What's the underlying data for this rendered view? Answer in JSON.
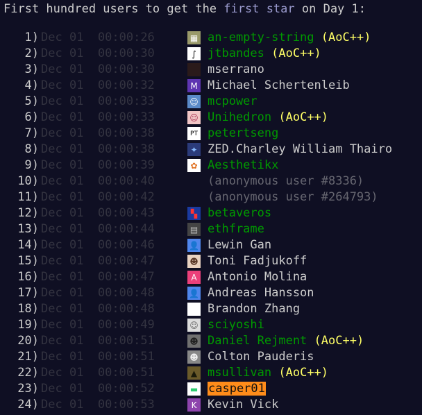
{
  "heading": {
    "prefix": "First hundred users to get the ",
    "highlight": "first star",
    "suffix": " on Day 1:"
  },
  "colors": {
    "background": "#0f0f23",
    "text": "#cccccc",
    "link_green": "#009900",
    "supporter_yellow": "#ffff66",
    "time_dim": "#333340",
    "highlight": "#9999cc",
    "sponsor_orange": "#ff8c1a"
  },
  "rows": [
    {
      "rank": "1)",
      "date": "Dec 01",
      "time": "00:00:26",
      "name": "an-empty-string",
      "supporter": "(AoC++)",
      "style": "linked",
      "avatar": {
        "icon": "pixel-art-avatar-icon",
        "bg": "#9a9a6a",
        "glyph": "▦"
      }
    },
    {
      "rank": "2)",
      "date": "Dec 01",
      "time": "00:00:30",
      "name": "jtbandes",
      "supporter": "(AoC++)",
      "style": "linked",
      "avatar": {
        "icon": "integral-sign-avatar-icon",
        "bg": "#ffffff",
        "glyph": "∫",
        "fg": "#000000"
      }
    },
    {
      "rank": "3)",
      "date": "Dec 01",
      "time": "00:00:30",
      "name": "mserrano",
      "supporter": "",
      "style": "plain",
      "avatar": {
        "icon": "dark-photo-avatar-icon",
        "bg": "#2a1a1a",
        "glyph": ""
      }
    },
    {
      "rank": "4)",
      "date": "Dec 01",
      "time": "00:00:32",
      "name": "Michael Schertenleib",
      "supporter": "",
      "style": "plain",
      "avatar": {
        "icon": "letter-m-avatar-icon",
        "bg": "#5e35b1",
        "glyph": "M"
      }
    },
    {
      "rank": "5)",
      "date": "Dec 01",
      "time": "00:00:33",
      "name": "mcpower",
      "supporter": "",
      "style": "linked",
      "avatar": {
        "icon": "anime-character-avatar-icon",
        "bg": "#5a8ac8",
        "glyph": "☺"
      }
    },
    {
      "rank": "6)",
      "date": "Dec 01",
      "time": "00:00:33",
      "name": "Unihedron",
      "supporter": "(AoC++)",
      "style": "linked",
      "avatar": {
        "icon": "anime-girl-avatar-icon",
        "bg": "#f2c6c6",
        "glyph": "☺",
        "fg": "#aa3355"
      }
    },
    {
      "rank": "7)",
      "date": "Dec 01",
      "time": "00:00:38",
      "name": "petertseng",
      "supporter": "",
      "style": "linked",
      "avatar": {
        "icon": "pt-monogram-avatar-icon",
        "bg": "#ffffff",
        "glyph": "PT",
        "fg": "#000000"
      }
    },
    {
      "rank": "8)",
      "date": "Dec 01",
      "time": "00:00:38",
      "name": "ZED.Charley William Thairo",
      "supporter": "",
      "style": "plain",
      "avatar": {
        "icon": "galaxy-avatar-icon",
        "bg": "#2b3b7a",
        "glyph": "✦",
        "fg": "#88bbff"
      }
    },
    {
      "rank": "9)",
      "date": "Dec 01",
      "time": "00:00:39",
      "name": "Aesthetikx",
      "supporter": "",
      "style": "linked",
      "avatar": {
        "icon": "orange-pattern-avatar-icon",
        "bg": "#ffffff",
        "glyph": "✿",
        "fg": "#e07020"
      }
    },
    {
      "rank": "10)",
      "date": "Dec 01",
      "time": "00:00:40",
      "name": "(anonymous user #8336)",
      "supporter": "",
      "style": "anon",
      "avatar": null
    },
    {
      "rank": "11)",
      "date": "Dec 01",
      "time": "00:00:42",
      "name": "(anonymous user #264793)",
      "supporter": "",
      "style": "anon",
      "avatar": null
    },
    {
      "rank": "12)",
      "date": "Dec 01",
      "time": "00:00:43",
      "name": "betaveros",
      "supporter": "",
      "style": "linked",
      "avatar": {
        "icon": "colorful-tiles-avatar-icon",
        "bg": "#1a3aa0",
        "glyph": "▚",
        "fg": "#ff3333"
      }
    },
    {
      "rank": "13)",
      "date": "Dec 01",
      "time": "00:00:44",
      "name": "ethframe",
      "supporter": "",
      "style": "linked",
      "avatar": {
        "icon": "grey-frame-avatar-icon",
        "bg": "#444444",
        "glyph": "▤",
        "fg": "#bbbbbb"
      }
    },
    {
      "rank": "14)",
      "date": "Dec 01",
      "time": "00:00:46",
      "name": "Lewin Gan",
      "supporter": "",
      "style": "plain",
      "avatar": {
        "icon": "default-person-avatar-icon",
        "bg": "#4f86ec",
        "glyph": "👤"
      }
    },
    {
      "rank": "15)",
      "date": "Dec 01",
      "time": "00:00:47",
      "name": "Toni Fadjukoff",
      "supporter": "",
      "style": "plain",
      "avatar": {
        "icon": "face-photo-avatar-icon",
        "bg": "#e8d2c0",
        "glyph": "☻",
        "fg": "#5a3a2a"
      }
    },
    {
      "rank": "16)",
      "date": "Dec 01",
      "time": "00:00:47",
      "name": "Antonio Molina",
      "supporter": "",
      "style": "plain",
      "avatar": {
        "icon": "letter-a-avatar-icon",
        "bg": "#ec407a",
        "glyph": "A"
      }
    },
    {
      "rank": "17)",
      "date": "Dec 01",
      "time": "00:00:48",
      "name": "Andreas Hansson",
      "supporter": "",
      "style": "plain",
      "avatar": {
        "icon": "default-person-avatar-icon",
        "bg": "#4f86ec",
        "glyph": "👤"
      }
    },
    {
      "rank": "18)",
      "date": "Dec 01",
      "time": "00:00:48",
      "name": "Brandon Zhang",
      "supporter": "",
      "style": "plain",
      "avatar": {
        "icon": "blank-white-avatar-icon",
        "bg": "#ffffff",
        "glyph": ""
      }
    },
    {
      "rank": "19)",
      "date": "Dec 01",
      "time": "00:00:49",
      "name": "sciyoshi",
      "supporter": "",
      "style": "linked",
      "avatar": {
        "icon": "sketch-avatar-icon",
        "bg": "#dddddd",
        "glyph": "☺",
        "fg": "#666666"
      }
    },
    {
      "rank": "20)",
      "date": "Dec 01",
      "time": "00:00:51",
      "name": "Daniel Rejment",
      "supporter": "(AoC++)",
      "style": "linked",
      "avatar": {
        "icon": "photo-avatar-icon",
        "bg": "#707070",
        "glyph": "☻",
        "fg": "#222222"
      }
    },
    {
      "rank": "21)",
      "date": "Dec 01",
      "time": "00:00:51",
      "name": "Colton Pauderis",
      "supporter": "",
      "style": "plain",
      "avatar": {
        "icon": "bw-photo-avatar-icon",
        "bg": "#888888",
        "glyph": "☻",
        "fg": "#eeeeee"
      }
    },
    {
      "rank": "22)",
      "date": "Dec 01",
      "time": "00:00:51",
      "name": "msullivan",
      "supporter": "(AoC++)",
      "style": "linked",
      "avatar": {
        "icon": "landscape-photo-avatar-icon",
        "bg": "#6a5a2a",
        "glyph": "▲",
        "fg": "#1a1a0a"
      }
    },
    {
      "rank": "23)",
      "date": "Dec 01",
      "time": "00:00:52",
      "name": "casper01",
      "supporter": "",
      "style": "sponsor",
      "avatar": {
        "icon": "green-bars-avatar-icon",
        "bg": "#ffffff",
        "glyph": "▬",
        "fg": "#2ecc71"
      }
    },
    {
      "rank": "24)",
      "date": "Dec 01",
      "time": "00:00:53",
      "name": "Kevin Vick",
      "supporter": "",
      "style": "plain",
      "avatar": {
        "icon": "letter-k-avatar-icon",
        "bg": "#8e44ad",
        "glyph": "K"
      }
    }
  ]
}
